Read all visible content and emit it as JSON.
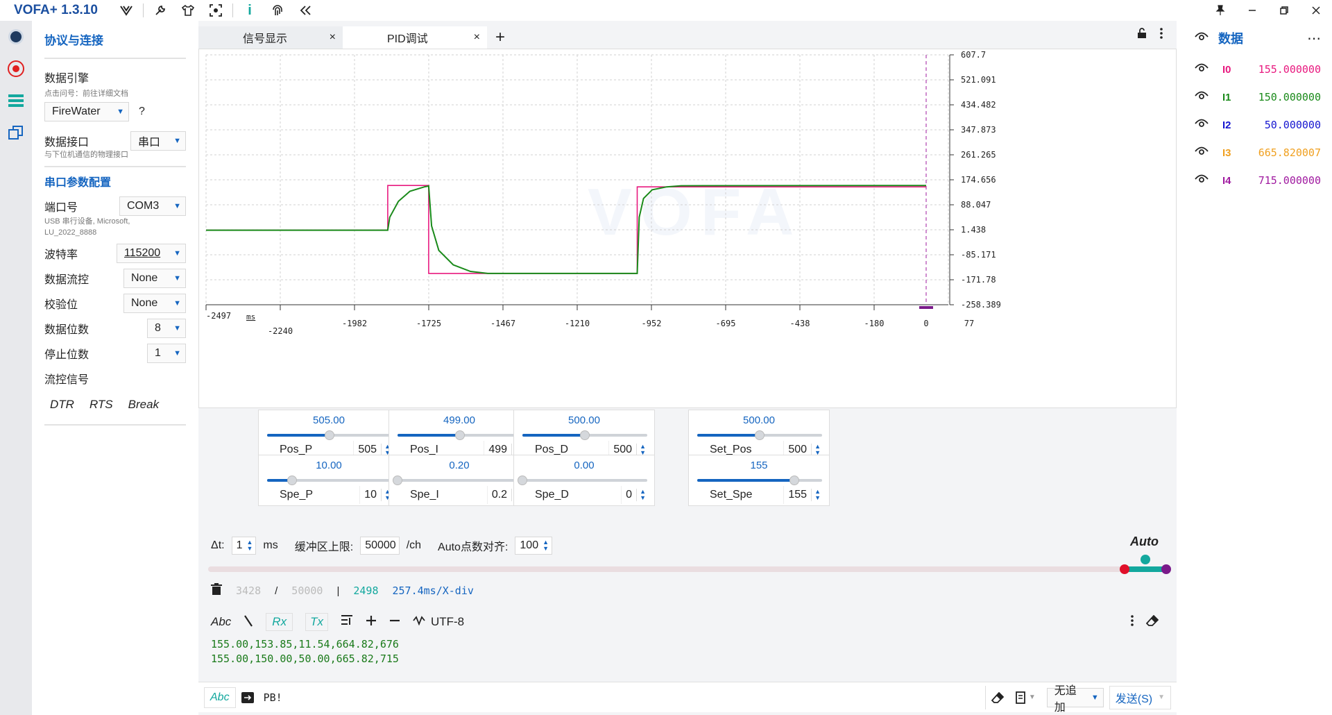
{
  "app": {
    "title": "VOFA+ 1.3.10"
  },
  "config": {
    "section_protocol": "协议与连接",
    "engine_label": "数据引擎",
    "engine_hint": "点击问号：前往详细文档",
    "engine_value": "FireWater",
    "help": "?",
    "interface_label": "数据接口",
    "interface_value": "串口",
    "interface_hint": "与下位机通信的物理接口",
    "section_serial": "串口参数配置",
    "port_label": "端口号",
    "port_value": "COM3",
    "port_desc": "USB 串行设备, Microsoft, LU_2022_8888",
    "baud_label": "波特率",
    "baud_value": "115200",
    "flow_label": "数据流控",
    "flow_value": "None",
    "parity_label": "校验位",
    "parity_value": "None",
    "databits_label": "数据位数",
    "databits_value": "8",
    "stopbits_label": "停止位数",
    "stopbits_value": "1",
    "flowsig_label": "流控信号",
    "dtr": "DTR",
    "rts": "RTS",
    "brk": "Break"
  },
  "tabs": [
    {
      "label": "信号显示",
      "close": "×"
    },
    {
      "label": "PID调试",
      "close": "×"
    }
  ],
  "tab_add": "+",
  "watermark": "VOFA",
  "chart_data": {
    "type": "line",
    "xlabel": "ms",
    "x_ticks": [
      "-2497",
      "-2240",
      "-1982",
      "-1725",
      "-1467",
      "-1210",
      "-952",
      "-695",
      "-438",
      "-180",
      "0",
      "77"
    ],
    "y_ticks": [
      "607.7",
      "521.091",
      "434.482",
      "347.873",
      "261.265",
      "174.656",
      "88.047",
      "1.438",
      "-85.171",
      "-171.78",
      "-258.389"
    ],
    "xlim": [
      -2497,
      77
    ],
    "ylim": [
      -258.389,
      607.7
    ],
    "grid": true,
    "cursor_x": 0,
    "series": [
      {
        "color": "#e8197f",
        "x": [
          -2497,
          -1867,
          -1867,
          -1725,
          -1725,
          -1002,
          -1002,
          0
        ],
        "y": [
          0,
          0,
          155,
          155,
          -150,
          -150,
          150,
          150
        ]
      },
      {
        "color": "#1a8a1a",
        "x": [
          -2497,
          -1867,
          -1860,
          -1830,
          -1790,
          -1740,
          -1725,
          -1715,
          -1690,
          -1640,
          -1580,
          -1520,
          -1002,
          -995,
          -980,
          -950,
          -900,
          -850,
          0
        ],
        "y": [
          0,
          0,
          45,
          100,
          135,
          150,
          153,
          15,
          -70,
          -120,
          -143,
          -150,
          -150,
          45,
          110,
          140,
          150,
          154,
          155
        ]
      }
    ]
  },
  "sliders": [
    {
      "value": "505.00",
      "name": "Pos_P",
      "num": "505",
      "frac": 0.5
    },
    {
      "value": "499.00",
      "name": "Pos_I",
      "num": "499",
      "frac": 0.5
    },
    {
      "value": "500.00",
      "name": "Pos_D",
      "num": "500",
      "frac": 0.5
    },
    {
      "value": "500.00",
      "name": "Set_Pos",
      "num": "500",
      "frac": 0.5
    },
    {
      "value": "10.00",
      "name": "Spe_P",
      "num": "10",
      "frac": 0.2
    },
    {
      "value": "0.20",
      "name": "Spe_I",
      "num": "0.2",
      "frac": 0.0
    },
    {
      "value": "0.00",
      "name": "Spe_D",
      "num": "0",
      "frac": 0.0
    },
    {
      "value": "155",
      "name": "Set_Spe",
      "num": "155",
      "frac": 0.78
    }
  ],
  "controls": {
    "dt_label": "Δt:",
    "dt_value": "1",
    "dt_unit": "ms",
    "buffer_label": "缓冲区上限:",
    "buffer_value": "50000",
    "buffer_unit": "/ch",
    "auto_align_label": "Auto点数对齐:",
    "auto_align_value": "100",
    "auto": "Auto"
  },
  "stats": {
    "count": "3428",
    "slash": "/",
    "limit": "50000",
    "bar": "|",
    "points": "2498",
    "xdiv": "257.4ms/X-div"
  },
  "cmd": {
    "abc": "Abc",
    "rx": "Rx",
    "tx": "Tx",
    "encoding": "UTF-8"
  },
  "terminal": [
    "155.00,153.85,11.54,664.82,676",
    "155.00,150.00,50.00,665.82,715"
  ],
  "send": {
    "abc": "Abc",
    "input": "PB!",
    "append": "无追加",
    "send": "发送(S)"
  },
  "data_panel": {
    "title": "数据",
    "channels": [
      {
        "name": "I0",
        "value": "155.000000",
        "color": "#e8197f"
      },
      {
        "name": "I1",
        "value": "150.000000",
        "color": "#1a8a1a"
      },
      {
        "name": "I2",
        "value": "50.000000",
        "color": "#1515d0"
      },
      {
        "name": "I3",
        "value": "665.820007",
        "color": "#f0a020"
      },
      {
        "name": "I4",
        "value": "715.000000",
        "color": "#a01aa0"
      }
    ]
  }
}
